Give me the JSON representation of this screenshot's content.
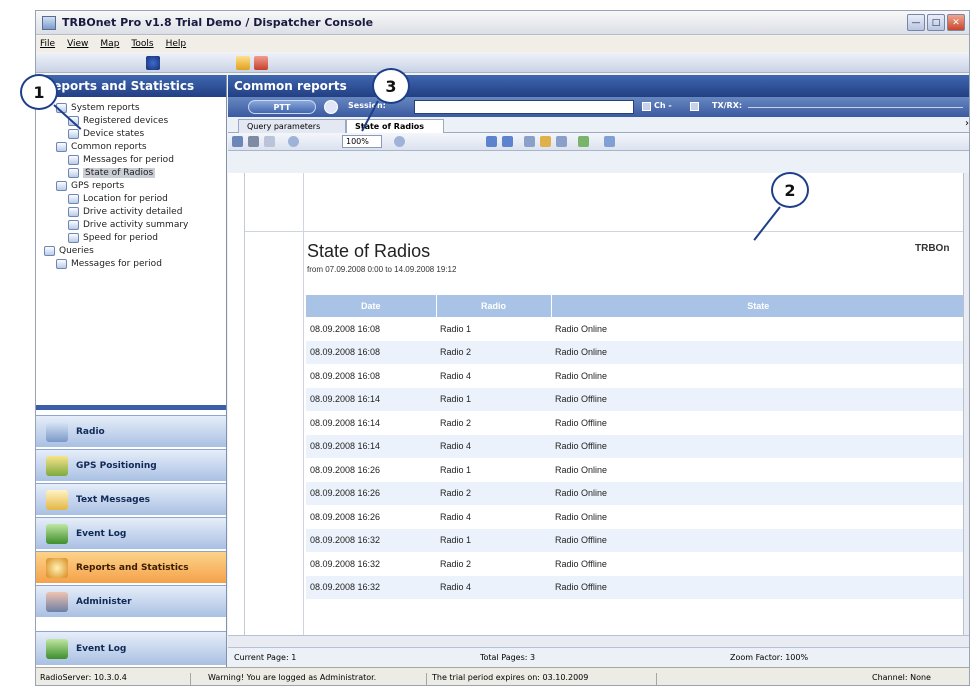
{
  "window": {
    "title": "TRBOnet Pro v1.8 Trial Demo / Dispatcher Console"
  },
  "menu": [
    "File",
    "View",
    "Map",
    "Tools",
    "Help"
  ],
  "left_panel": {
    "title": "Reports and Statistics",
    "tree": [
      {
        "label": "System reports",
        "level": 1
      },
      {
        "label": "Registered devices",
        "level": 2
      },
      {
        "label": "Device states",
        "level": 2
      },
      {
        "label": "Common reports",
        "level": 1
      },
      {
        "label": "Messages for period",
        "level": 2
      },
      {
        "label": "State of Radios",
        "level": 2,
        "selected": true
      },
      {
        "label": "GPS reports",
        "level": 1
      },
      {
        "label": "Location for period",
        "level": 2
      },
      {
        "label": "Drive activity detailed",
        "level": 2
      },
      {
        "label": "Drive activity summary",
        "level": 2
      },
      {
        "label": "Speed for period",
        "level": 2
      },
      {
        "label": "Queries",
        "level": 1
      },
      {
        "label": "Messages for period",
        "level": 2
      }
    ],
    "nav_buttons": [
      {
        "label": "Radio",
        "icon": "radio-icon"
      },
      {
        "label": "GPS Positioning",
        "icon": "gps-icon"
      },
      {
        "label": "Text Messages",
        "icon": "message-icon"
      },
      {
        "label": "Event Log",
        "icon": "event-log-icon"
      },
      {
        "label": "Reports and Statistics",
        "icon": "reports-icon",
        "active": true
      },
      {
        "label": "Administer",
        "icon": "administer-icon"
      },
      {
        "label": "Event Log",
        "icon": "event-log-icon"
      }
    ]
  },
  "main": {
    "title": "Common reports",
    "ptt": {
      "button": "PTT",
      "session_label": "Session:",
      "ch_label": "Ch -",
      "txrx_label": "TX/RX:"
    },
    "tabs": [
      {
        "label": "Query parameters"
      },
      {
        "label": "State of Radios",
        "active": true
      }
    ],
    "zoom": "100%",
    "report": {
      "title": "State of Radios",
      "subtitle": "from 07.09.2008 0:00 to 14.09.2008 19:12",
      "brand": "TRBOn",
      "columns": [
        "Date",
        "Radio",
        "State"
      ],
      "rows": [
        [
          "08.09.2008 16:08",
          "Radio 1",
          "Radio Online"
        ],
        [
          "08.09.2008 16:08",
          "Radio 2",
          "Radio Online"
        ],
        [
          "08.09.2008 16:08",
          "Radio 4",
          "Radio Online"
        ],
        [
          "08.09.2008 16:14",
          "Radio 1",
          "Radio Offline"
        ],
        [
          "08.09.2008 16:14",
          "Radio 2",
          "Radio Offline"
        ],
        [
          "08.09.2008 16:14",
          "Radio 4",
          "Radio Offline"
        ],
        [
          "08.09.2008 16:26",
          "Radio 1",
          "Radio Online"
        ],
        [
          "08.09.2008 16:26",
          "Radio 2",
          "Radio Online"
        ],
        [
          "08.09.2008 16:26",
          "Radio 4",
          "Radio Online"
        ],
        [
          "08.09.2008 16:32",
          "Radio 1",
          "Radio Offline"
        ],
        [
          "08.09.2008 16:32",
          "Radio 2",
          "Radio Offline"
        ],
        [
          "08.09.2008 16:32",
          "Radio 4",
          "Radio Offline"
        ]
      ]
    },
    "status": {
      "current_page": "Current Page: 1",
      "total_pages": "Total Pages: 3",
      "zoom_factor": "Zoom Factor: 100%"
    }
  },
  "status_bar": {
    "server": "RadioServer: 10.3.0.4",
    "warning": "Warning! You are logged as Administrator.",
    "trial": "The trial period expires on: 03.10.2009",
    "channel": "Channel: None"
  },
  "callouts": [
    "1",
    "2",
    "3"
  ],
  "colors": {
    "header_blue": "#233f83",
    "active_orange": "#f5a24a",
    "table_header": "#a9c3e6"
  }
}
